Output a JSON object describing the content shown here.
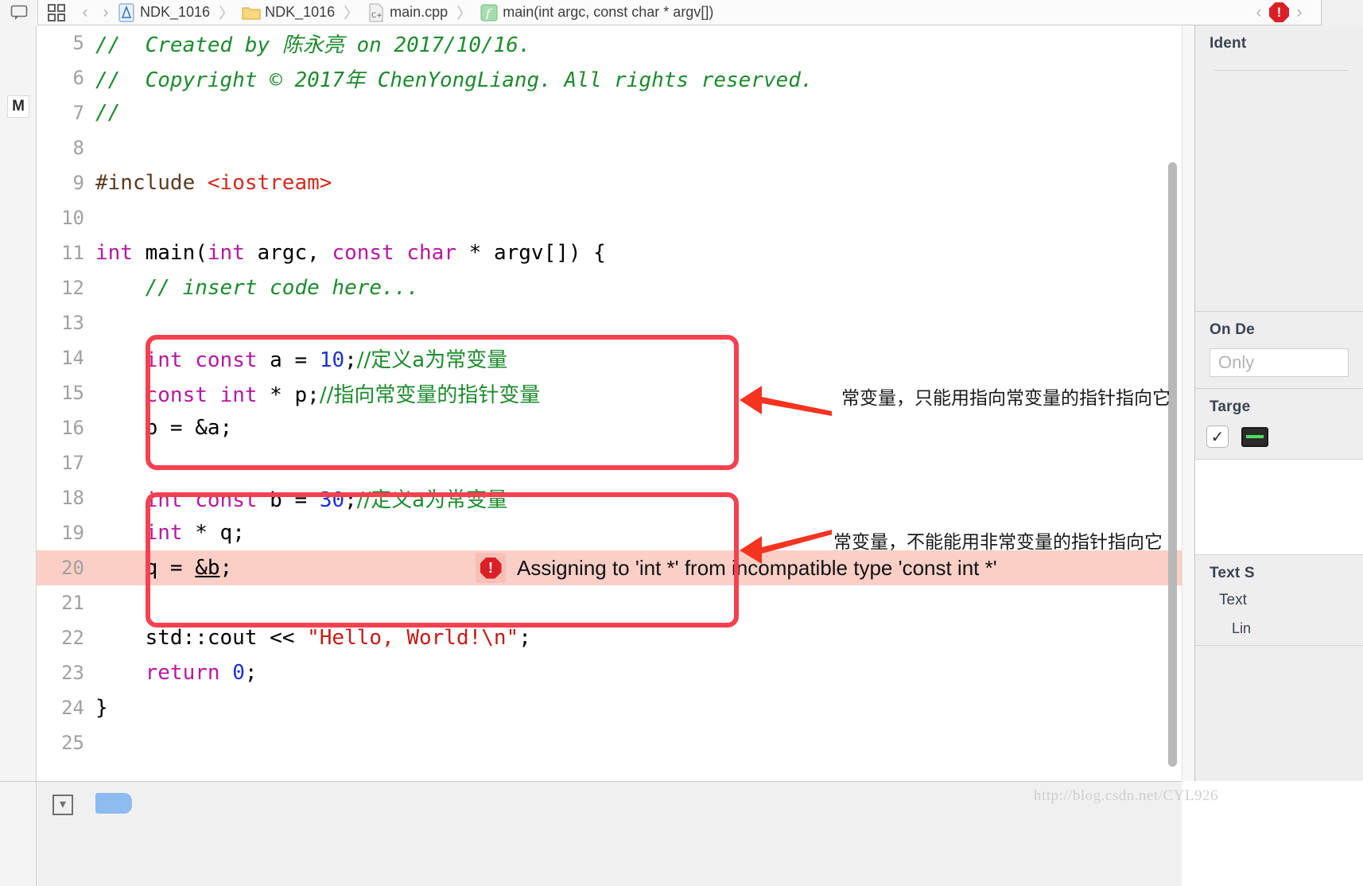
{
  "toolbar": {
    "related_items_icon": "related-items-icon",
    "grid_icon": "grid-icon",
    "back_label": "‹",
    "forward_label": "›",
    "breadcrumbs": [
      {
        "icon": "project-icon",
        "label": "NDK_1016"
      },
      {
        "icon": "folder-icon",
        "label": "NDK_1016"
      },
      {
        "icon": "cpp-file-icon",
        "label": "main.cpp"
      },
      {
        "icon": "function-icon",
        "label": "main(int argc, const char * argv[])"
      }
    ],
    "separator": "〉",
    "issue_prev": "‹",
    "issue_next": "›",
    "issue_badge": "!"
  },
  "left_ribbon": {
    "modified_badge": "M"
  },
  "editor": {
    "lines": [
      {
        "n": "5",
        "tokens": [
          {
            "t": "//  Created by 陈永亮 on 2017/10/16.",
            "c": "cmt"
          }
        ]
      },
      {
        "n": "6",
        "tokens": [
          {
            "t": "//  Copyright © 2017年 ChenYongLiang. All rights reserved.",
            "c": "cmt"
          }
        ]
      },
      {
        "n": "7",
        "tokens": [
          {
            "t": "//",
            "c": "cmt"
          }
        ]
      },
      {
        "n": "8",
        "tokens": []
      },
      {
        "n": "9",
        "tokens": [
          {
            "t": "#include ",
            "c": "pre"
          },
          {
            "t": "<iostream>",
            "c": "hdr"
          }
        ]
      },
      {
        "n": "10",
        "tokens": []
      },
      {
        "n": "11",
        "tokens": [
          {
            "t": "int",
            "c": "kw"
          },
          {
            "t": " main(",
            "c": ""
          },
          {
            "t": "int",
            "c": "kw"
          },
          {
            "t": " argc, ",
            "c": ""
          },
          {
            "t": "const",
            "c": "kw"
          },
          {
            "t": " ",
            "c": ""
          },
          {
            "t": "char",
            "c": "kw"
          },
          {
            "t": " * argv[]) {",
            "c": ""
          }
        ]
      },
      {
        "n": "12",
        "tokens": [
          {
            "t": "    // insert code here...",
            "c": "cmt"
          }
        ]
      },
      {
        "n": "13",
        "tokens": []
      },
      {
        "n": "14",
        "tokens": [
          {
            "t": "    ",
            "c": ""
          },
          {
            "t": "int",
            "c": "kw"
          },
          {
            "t": " ",
            "c": ""
          },
          {
            "t": "const",
            "c": "kw"
          },
          {
            "t": " a = ",
            "c": ""
          },
          {
            "t": "10",
            "c": "num"
          },
          {
            "t": ";",
            "c": ""
          },
          {
            "t": "//定义a为常变量",
            "c": "cmt-cn"
          }
        ]
      },
      {
        "n": "15",
        "tokens": [
          {
            "t": "    ",
            "c": ""
          },
          {
            "t": "const",
            "c": "kw"
          },
          {
            "t": " ",
            "c": ""
          },
          {
            "t": "int",
            "c": "kw"
          },
          {
            "t": " * p;",
            "c": ""
          },
          {
            "t": "//指向常变量的指针变量",
            "c": "cmt-cn"
          }
        ]
      },
      {
        "n": "16",
        "tokens": [
          {
            "t": "    p = &a;",
            "c": ""
          }
        ]
      },
      {
        "n": "17",
        "tokens": []
      },
      {
        "n": "18",
        "tokens": [
          {
            "t": "    ",
            "c": ""
          },
          {
            "t": "int",
            "c": "kw"
          },
          {
            "t": " ",
            "c": ""
          },
          {
            "t": "const",
            "c": "kw"
          },
          {
            "t": " b = ",
            "c": ""
          },
          {
            "t": "30",
            "c": "num"
          },
          {
            "t": ";",
            "c": ""
          },
          {
            "t": "//定义a为常变量",
            "c": "cmt-cn"
          }
        ]
      },
      {
        "n": "19",
        "tokens": [
          {
            "t": "    ",
            "c": ""
          },
          {
            "t": "int",
            "c": "kw"
          },
          {
            "t": " * q;",
            "c": ""
          }
        ]
      },
      {
        "n": "20",
        "tokens": [
          {
            "t": "    q = ",
            "c": ""
          },
          {
            "t": "&b",
            "c": "und"
          },
          {
            "t": ";",
            "c": ""
          }
        ],
        "error": true
      },
      {
        "n": "21",
        "tokens": []
      },
      {
        "n": "22",
        "tokens": [
          {
            "t": "    std::cout << ",
            "c": ""
          },
          {
            "t": "\"Hello, World!\\n\"",
            "c": "str"
          },
          {
            "t": ";",
            "c": ""
          }
        ]
      },
      {
        "n": "23",
        "tokens": [
          {
            "t": "    ",
            "c": ""
          },
          {
            "t": "return",
            "c": "kw"
          },
          {
            "t": " ",
            "c": ""
          },
          {
            "t": "0",
            "c": "num"
          },
          {
            "t": ";",
            "c": ""
          }
        ]
      },
      {
        "n": "24",
        "tokens": [
          {
            "t": "}",
            "c": ""
          }
        ]
      },
      {
        "n": "25",
        "tokens": []
      }
    ],
    "inline_error": {
      "icon": "error-octagon-icon",
      "icon_glyph": "!",
      "message": "Assigning to 'int *' from incompatible type 'const int *'"
    }
  },
  "annotations": [
    {
      "name": "annotation-const-pointer",
      "text": "常变量，只能用指向常变量的指针指向它"
    },
    {
      "name": "annotation-nonconst-pointer",
      "text": "常变量，不能能用非常变量的指针指向它"
    }
  ],
  "inspector": {
    "identity_title": "Ident",
    "on_demand_title": "On De",
    "on_demand_placeholder": "Only",
    "target_title": "Targe",
    "target_check": "✓",
    "text_settings_title": "Text S",
    "text_sub": "Text",
    "line_sub": "Lin"
  },
  "bottom": {
    "filter_icon": "filter-icon",
    "tag_icon": "tag-icon"
  },
  "watermark": "http://blog.csdn.net/CYL926",
  "colors": {
    "keyword": "#b5199e",
    "number": "#1d2fd4",
    "comment": "#1e8a2e",
    "string": "#c41a16",
    "header": "#d12b20",
    "preproc": "#5c3a21",
    "annotation_red": "#f5414f",
    "error_bg": "#fbcfc6",
    "error_red": "#da1f26"
  }
}
